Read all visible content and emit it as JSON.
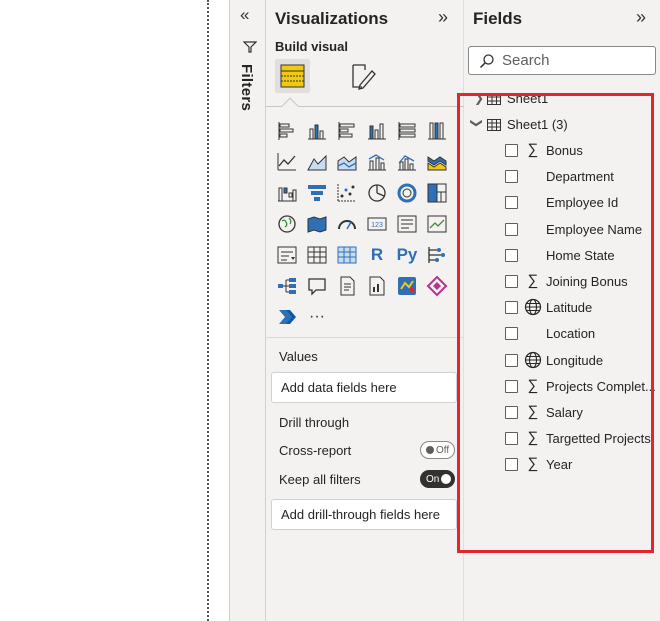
{
  "filters": {
    "label": "Filters"
  },
  "visualizations": {
    "title": "Visualizations",
    "build_label": "Build visual",
    "icons": [
      "stacked-bar-icon",
      "stacked-column-icon",
      "clustered-bar-icon",
      "clustered-column-icon",
      "100-bar-icon",
      "100-column-icon",
      "line-chart-icon",
      "area-chart-icon",
      "stacked-area-icon",
      "line-column-icon",
      "line-clustered-column-icon",
      "ribbon-chart-icon",
      "waterfall-icon",
      "funnel-icon",
      "scatter-icon",
      "pie-chart-icon",
      "donut-chart-icon",
      "treemap-icon",
      "map-icon",
      "filled-map-icon",
      "gauge-icon",
      "card-icon",
      "multirow-card-icon",
      "kpi-icon",
      "slicer-icon",
      "table-icon",
      "matrix-icon",
      "r-visual-icon",
      "python-visual-icon",
      "key-influencers-icon",
      "decomposition-tree-icon",
      "qa-icon",
      "narrative-icon",
      "paginated-report-icon",
      "azure-map-icon",
      "power-apps-icon",
      "power-automate-icon",
      "more-visuals-icon"
    ],
    "r_label": "R",
    "py_label": "Py",
    "more_label": "···",
    "values_label": "Values",
    "values_placeholder": "Add data fields here",
    "drill_label": "Drill through",
    "cross_report_label": "Cross-report",
    "cross_report_state": "Off",
    "keep_filters_label": "Keep all filters",
    "keep_filters_state": "On",
    "drill_placeholder": "Add drill-through fields here"
  },
  "fields": {
    "title": "Fields",
    "search_placeholder": "Search",
    "tables": [
      {
        "name": "Sheet1",
        "expanded": false
      },
      {
        "name": "Sheet1 (3)",
        "expanded": true
      }
    ],
    "items": [
      {
        "label": "Bonus",
        "icon": "sigma"
      },
      {
        "label": "Department",
        "icon": ""
      },
      {
        "label": "Employee Id",
        "icon": ""
      },
      {
        "label": "Employee Name",
        "icon": ""
      },
      {
        "label": "Home State",
        "icon": ""
      },
      {
        "label": "Joining Bonus",
        "icon": "sigma"
      },
      {
        "label": "Latitude",
        "icon": "globe"
      },
      {
        "label": "Location",
        "icon": ""
      },
      {
        "label": "Longitude",
        "icon": "globe"
      },
      {
        "label": "Projects Complet...",
        "icon": "sigma"
      },
      {
        "label": "Salary",
        "icon": "sigma"
      },
      {
        "label": "Targetted Projects",
        "icon": "sigma"
      },
      {
        "label": "Year",
        "icon": "sigma"
      }
    ]
  },
  "colors": {
    "highlight": "#e3262b",
    "accent_yellow": "#f2c811",
    "accent_blue": "#2f6fb5"
  }
}
